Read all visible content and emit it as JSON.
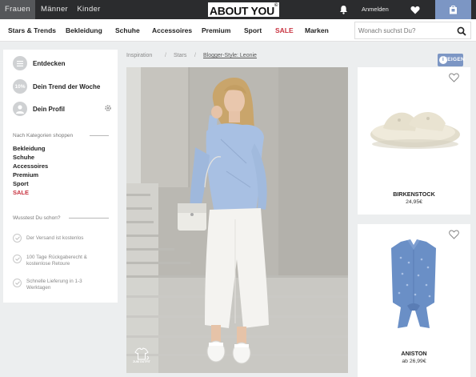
{
  "topbar": {
    "tabs": [
      {
        "label": "Frauen",
        "active": true
      },
      {
        "label": "Männer",
        "active": false
      },
      {
        "label": "Kinder",
        "active": false
      }
    ],
    "logo": "ABOUT YOU",
    "logo_mark": "©",
    "login_label": "Anmelden",
    "icons": [
      "bell-icon",
      "heart-icon",
      "shopping-bag-icon"
    ]
  },
  "nav": {
    "items": [
      "Stars & Trends",
      "Bekleidung",
      "Schuhe",
      "Accessoires",
      "Premium",
      "Sport",
      "SALE",
      "Marken"
    ],
    "search_placeholder": "Wonach suchst Du?"
  },
  "sidebar": {
    "top_items": [
      {
        "label": "Entdecken",
        "icon": "list-icon"
      },
      {
        "label": "Dein Trend der Woche",
        "badge": "10%"
      },
      {
        "label": "Dein Profil",
        "icon": "user-icon"
      }
    ],
    "category_heading": "Nach Kategorien shoppen",
    "categories": [
      "Bekleidung",
      "Schuhe",
      "Accessoires",
      "Premium",
      "Sport",
      "SALE"
    ],
    "facts_heading": "Wusstest Du schon?",
    "facts": [
      "Der Versand ist kostenlos",
      "100 Tage Rückgaberecht & kostenlose Retoure",
      "Schnelle Lieferung in 1-3 Werktagen"
    ]
  },
  "breadcrumb": {
    "items": [
      "Inspiration",
      "Stars",
      "Blogger-Style: Leonie"
    ],
    "separator": "/"
  },
  "hero": {
    "badge_label": "ZUM OUTFIT"
  },
  "tag_button": {
    "label": "ZEIGEN",
    "icon_glyph": "i"
  },
  "products": [
    {
      "brand": "BIRKENSTOCK",
      "price": "24,95€",
      "image": "sandal"
    },
    {
      "brand": "ANISTON",
      "price": "ab 26,99€",
      "image": "blouse"
    }
  ],
  "colors": {
    "accent": "#7c96c4",
    "sale": "#c8323f",
    "topbar": "#2b2c2e"
  }
}
